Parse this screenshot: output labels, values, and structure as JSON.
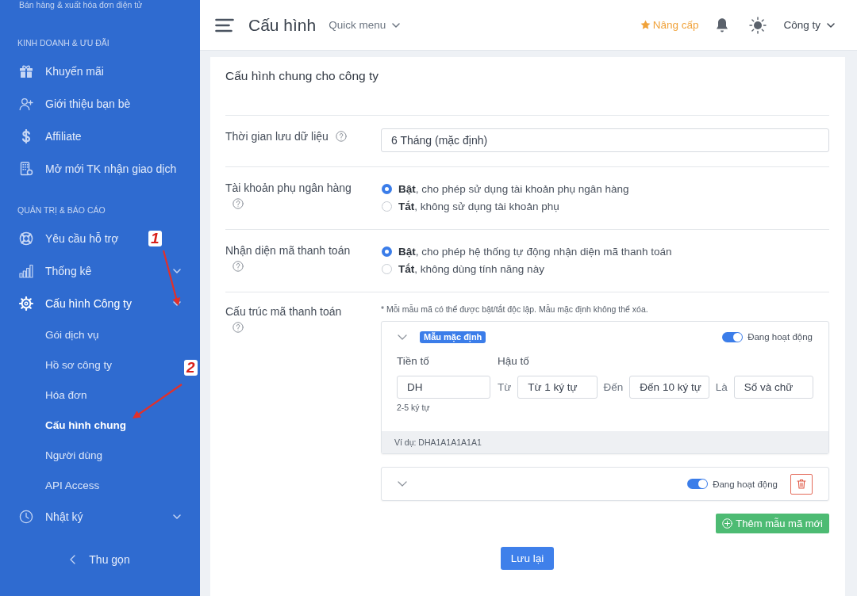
{
  "sidebar": {
    "tagline": "Bán hàng & xuất hóa đơn điện tử",
    "sections": [
      {
        "title": "KINH DOANH & ƯU ĐÃI",
        "items": [
          {
            "label": "Khuyến mãi",
            "kind": "link"
          },
          {
            "label": "Giới thiệu bạn bè",
            "kind": "link"
          },
          {
            "label": "Affiliate",
            "kind": "link"
          },
          {
            "label": "Mở mới TK nhận giao dịch",
            "kind": "link"
          }
        ]
      },
      {
        "title": "QUẢN TRỊ & BÁO CÁO",
        "items": [
          {
            "label": "Yêu cầu hỗ trợ",
            "kind": "link"
          },
          {
            "label": "Thống kê",
            "kind": "group",
            "expanded": false
          },
          {
            "label": "Cấu hình Công ty",
            "kind": "group",
            "expanded": true,
            "children": [
              {
                "label": "Gói dịch vụ",
                "selected": false
              },
              {
                "label": "Hồ sơ công ty",
                "selected": false
              },
              {
                "label": "Hóa đơn",
                "selected": false
              },
              {
                "label": "Cấu hình chung",
                "selected": true
              },
              {
                "label": "Người dùng",
                "selected": false
              },
              {
                "label": "API Access",
                "selected": false
              }
            ]
          },
          {
            "label": "Nhật ký",
            "kind": "group",
            "expanded": false
          }
        ]
      }
    ],
    "collapse": "Thu gọn"
  },
  "header": {
    "title": "Cấu hình",
    "quick_menu": "Quick menu",
    "upgrade": "Nâng cấp",
    "company": "Công ty"
  },
  "settings": {
    "title": "Cấu hình chung cho công ty",
    "retention": {
      "label": "Thời gian lưu dữ liệu",
      "value": "6 Tháng (mặc định)"
    },
    "options": [
      {
        "label": "Tài khoản phụ ngân hàng",
        "choices": [
          {
            "text": "**Bật**, cho phép sử dụng tài khoản phụ ngân hàng",
            "selected": true
          },
          {
            "text": "**Tắt**, không sử dụng tài khoản phụ",
            "selected": false
          }
        ]
      },
      {
        "label": "Nhận diện mã thanh toán",
        "choices": [
          {
            "text": "**Bật**, cho phép hệ thống tự động nhận diện mã thanh toán",
            "selected": true
          },
          {
            "text": "**Tắt**, không dùng tính năng này",
            "selected": false
          }
        ]
      }
    ],
    "payment_code": {
      "label": "Cấu trúc mã thanh toán",
      "note": "* Mỗi mẫu mã có thể được bật/tắt độc lập. Mẫu mặc định không thể xóa.",
      "templates": [
        {
          "badge": "Mẫu mặc định",
          "expanded": true,
          "on": true,
          "status": "Đang hoạt động",
          "deletable": false,
          "prefix": {
            "label": "Tiền tố",
            "value": "DH",
            "hint": "2-5 ký tự"
          },
          "suffix": {
            "label": "Hậu tố",
            "parts": [
              {
                "word": "Từ",
                "value": "Từ 1 ký tự"
              },
              {
                "word": "Đến",
                "value": "Đến 10 ký tự"
              },
              {
                "word": "Là",
                "value": "Số và chữ"
              }
            ]
          },
          "example": "Ví dụ: DHA1A1A1A1A1"
        },
        {
          "expanded": false,
          "on": true,
          "status": "Đang hoạt động",
          "deletable": true
        }
      ],
      "add_button": "Thêm mẫu mã mới"
    },
    "save_button": "Lưu lại"
  },
  "annotations": [
    {
      "label": "1"
    },
    {
      "label": "2"
    }
  ]
}
